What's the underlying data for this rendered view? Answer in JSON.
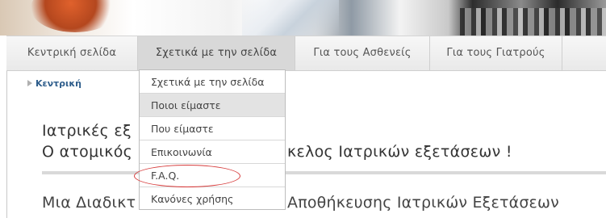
{
  "nav": {
    "items": [
      {
        "label": "Κεντρική σελίδα",
        "active": false
      },
      {
        "label": "Σχετικά με την σελίδα",
        "active": true
      },
      {
        "label": "Για τους Ασθενείς",
        "active": false
      },
      {
        "label": "Για τους Γιατρούς",
        "active": false
      }
    ]
  },
  "dropdown": {
    "items": [
      {
        "label": "Σχετικά με την σελίδα"
      },
      {
        "label": "Ποιοι είμαστε",
        "highlighted": true
      },
      {
        "label": "Που είμαστε"
      },
      {
        "label": "Επικοινωνία"
      },
      {
        "label": "F.A.Q.",
        "circled": true
      },
      {
        "label": "Κανόνες χρήσης"
      }
    ]
  },
  "breadcrumb": {
    "label": "Κεντρική"
  },
  "content": {
    "title_line1": "Ιατρικές εξ",
    "title_line2": "Ο ατομικός",
    "title_line2_tail": "κελος Ιατρικών εξετάσεων !",
    "body_prefix": "Μια Διαδικτ",
    "body_suffix": "Αποθήκευσης Ιατρικών Εξετάσεων"
  },
  "colors": {
    "accent": "#2f5e8c",
    "annotation": "#d63a3a"
  }
}
